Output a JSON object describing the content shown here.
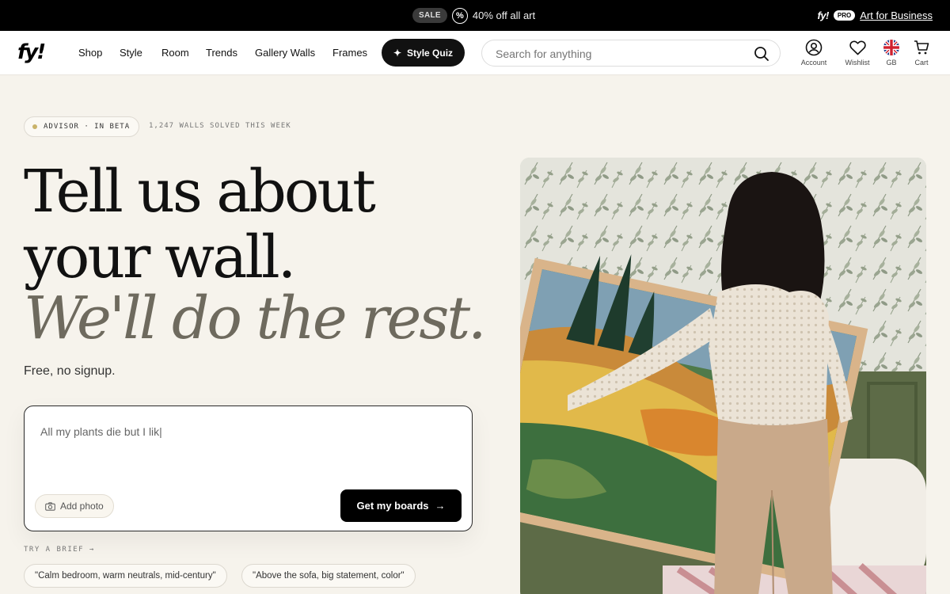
{
  "promo": {
    "sale_label": "SALE",
    "offer_text": "40% off all art",
    "pro_brand": "fy!",
    "pro_badge": "PRO",
    "business_link": "Art for Business"
  },
  "header": {
    "logo": "fy!",
    "nav": [
      "Shop",
      "Style",
      "Room",
      "Trends",
      "Gallery Walls",
      "Frames"
    ],
    "style_quiz": "Style Quiz",
    "search_placeholder": "Search for anything",
    "icons": {
      "account": "Account",
      "wishlist": "Wishlist",
      "region": "GB",
      "cart": "Cart"
    }
  },
  "hero": {
    "badge": "ADVISOR · IN BETA",
    "walls_solved": "1,247 WALLS SOLVED THIS WEEK",
    "headline_line1": "Tell us about",
    "headline_line2": "your wall.",
    "headline_line3": "We'll do the rest.",
    "subline": "Free, no signup.",
    "brief_value": "All my plants die but I lik|",
    "add_photo": "Add photo",
    "cta": "Get my boards",
    "try_brief": "TRY A BRIEF →",
    "chips": [
      "\"Calm bedroom, warm neutrals, mid-century\"",
      "\"Above the sofa, big statement, color\""
    ]
  },
  "colors": {
    "page_bg": "#f6f3ec",
    "promo_bg": "#000000",
    "accent_dark": "#111111",
    "headline_italic": "#6e6a5e",
    "wall_green": "#5d6b47"
  }
}
